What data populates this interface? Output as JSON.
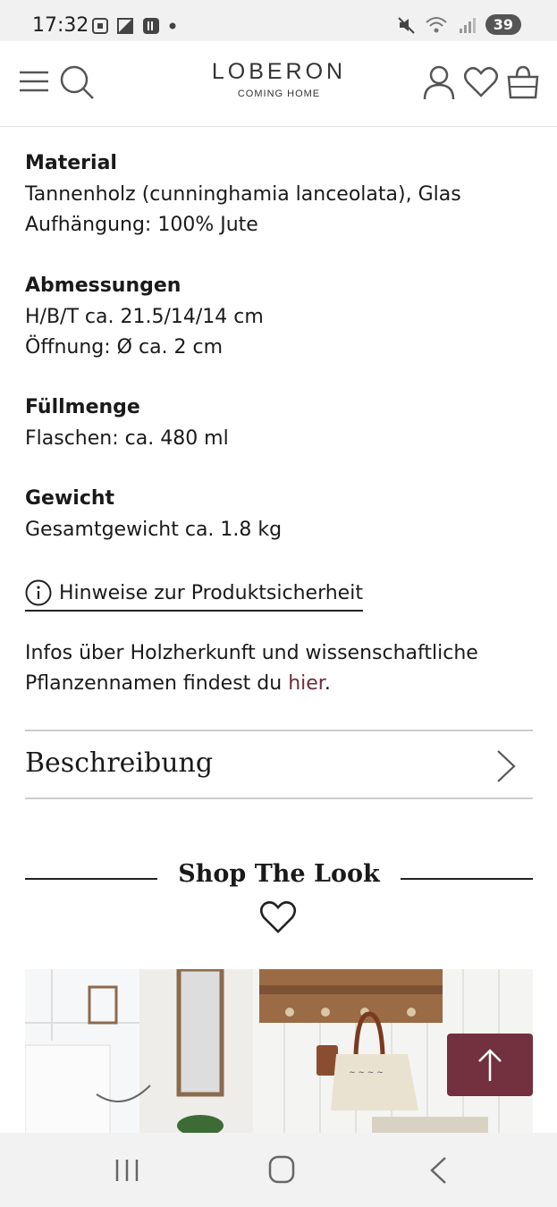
{
  "status_bar": {
    "time": "17:32",
    "battery": "39"
  },
  "header": {
    "logo_main": "LOBERON",
    "logo_sub": "COMING HOME",
    "icons": [
      "menu-icon",
      "search-icon",
      "user-icon",
      "heart-icon",
      "bag-icon"
    ]
  },
  "specs": [
    {
      "heading": "Material",
      "lines": [
        "Tannenholz (cunninghamia lanceolata), Glas",
        "Aufhängung: 100% Jute"
      ]
    },
    {
      "heading": "Abmessungen",
      "lines": [
        "H/B/T ca. 21.5/14/14 cm",
        "Öffnung: Ø ca. 2 cm"
      ]
    },
    {
      "heading": "Füllmenge",
      "lines": [
        "Flaschen: ca. 480 ml"
      ]
    },
    {
      "heading": "Gewicht",
      "lines": [
        "Gesamtgewicht ca. 1.8 kg"
      ]
    }
  ],
  "safety_link": "Hinweise zur Produktsicherheit",
  "info": {
    "text_before": "Infos über Holzherkunft und wissenschaftliche Pflanzennamen findest du ",
    "link": "hier",
    "text_after": "."
  },
  "accordion": {
    "title": "Beschreibung"
  },
  "shop_the_look": {
    "title": "Shop The Look"
  },
  "colors": {
    "accent": "#73303f",
    "link": "#6e2b3c"
  }
}
